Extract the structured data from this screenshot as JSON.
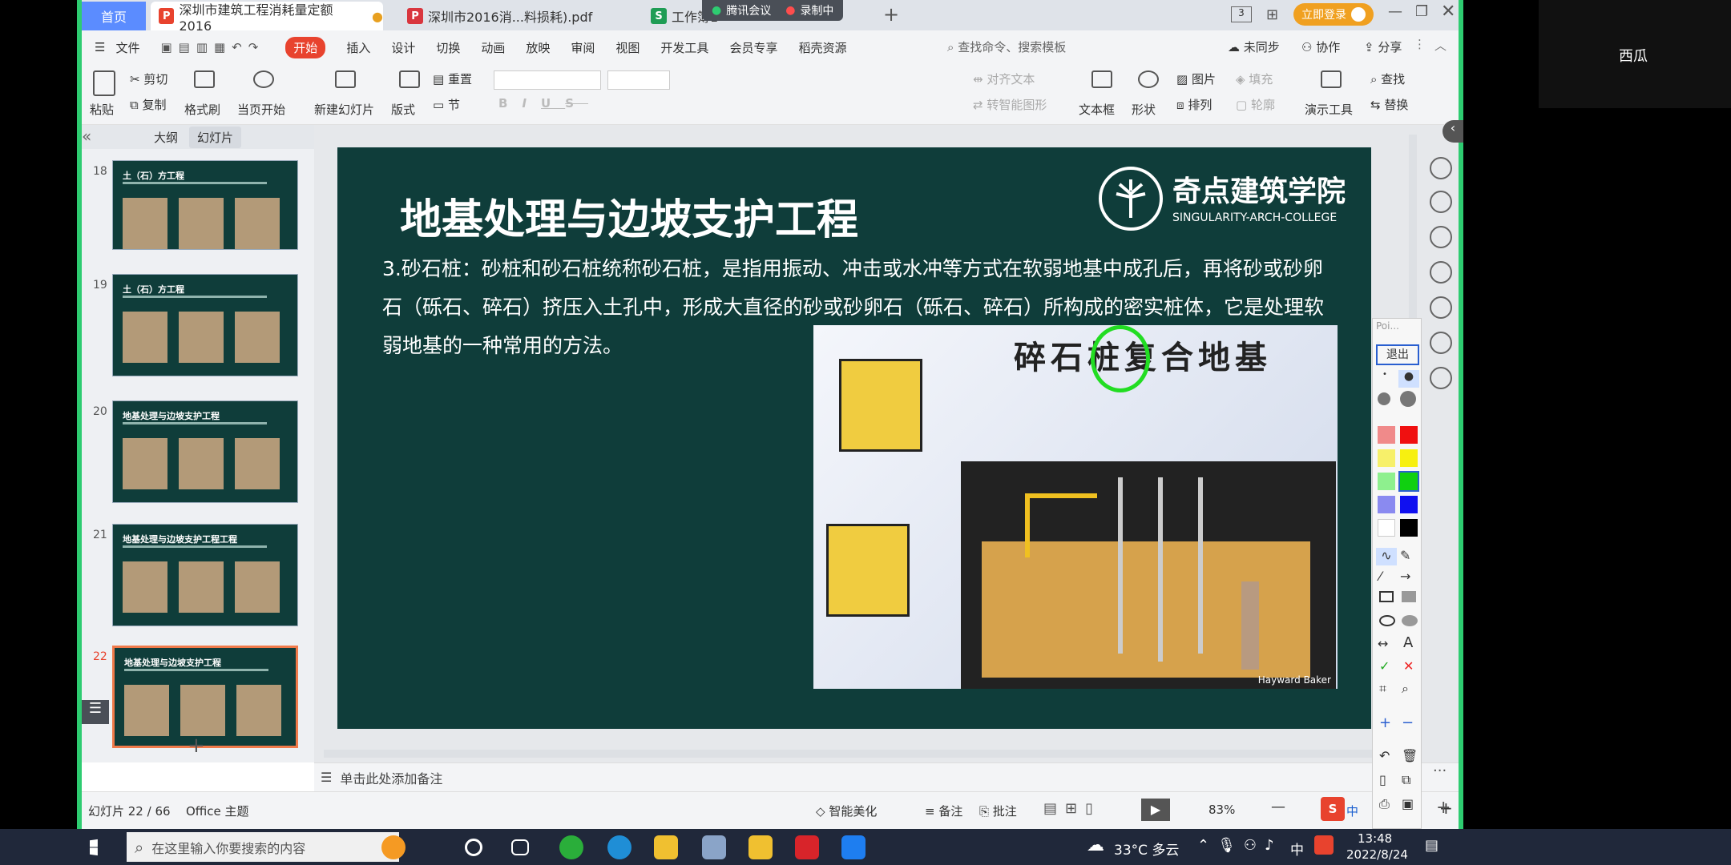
{
  "tabs": {
    "home": "首页",
    "doc1": "深圳市建筑工程消耗量定额2016",
    "doc2": "深圳市2016消...料损耗).pdf",
    "doc3": "工作簿1",
    "add": "+"
  },
  "meeting": {
    "app": "腾讯会议",
    "recording": "录制中"
  },
  "title_bar": {
    "page_indicator": "3",
    "login": "立即登录"
  },
  "menu": {
    "file": "文件",
    "items": [
      "开始",
      "插入",
      "设计",
      "切换",
      "动画",
      "放映",
      "审阅",
      "视图",
      "开发工具",
      "会员专享",
      "稻壳资源"
    ],
    "search": "查找命令、搜索模板",
    "sync": "未同步",
    "collab": "协作",
    "share": "分享"
  },
  "toolbar": {
    "paste": "粘贴",
    "cut": "剪切",
    "copy": "复制",
    "format_brush": "格式刷",
    "play_current": "当页开始",
    "new_slide": "新建幻灯片",
    "layout": "版式",
    "reset": "重置",
    "section": "节",
    "align_text": "对齐文本",
    "convert_smart": "转智能图形",
    "textbox": "文本框",
    "shape": "形状",
    "picture": "图片",
    "arrange": "排列",
    "fill": "填充",
    "outline": "轮廓",
    "presenter": "演示工具",
    "find": "查找",
    "replace": "替换",
    "bold": "B",
    "italic": "I",
    "underline": "U",
    "strike": "S"
  },
  "panel": {
    "outline": "大纲",
    "slides": "幻灯片",
    "add": "+"
  },
  "thumbnails": [
    {
      "num": "18",
      "title": "土（石）方工程"
    },
    {
      "num": "19",
      "title": "土（石）方工程"
    },
    {
      "num": "20",
      "title": "地基处理与边坡支护工程"
    },
    {
      "num": "21",
      "title": "地基处理与边坡支护工程工程"
    },
    {
      "num": "22",
      "title": "地基处理与边坡支护工程"
    }
  ],
  "slide": {
    "title": "地基处理与边坡支护工程",
    "logo_cn": "奇点建筑学院",
    "logo_en": "SINGULARITY-ARCH-COLLEGE",
    "body": "3.砂石桩：砂桩和砂石桩统称砂石桩，是指用振动、冲击或水冲等方式在软弱地基中成孔后，再将砂或砂卵石（砾石、碎石）挤压入土孔中，形成大直径的砂或砂卵石（砾石、碎石）所构成的密实桩体，它是处理软弱地基的一种常用的方法。",
    "figure_title": "碎石桩复合地基",
    "credit": "Hayward Baker"
  },
  "notes": "单击此处添加备注",
  "status": {
    "slide_no": "幻灯片 22 / 66",
    "theme": "Office 主题",
    "beautify": "智能美化",
    "notes": "备注",
    "comment": "批注",
    "zoom": "83%"
  },
  "pen": {
    "pointer": "Poi...",
    "exit": "退出"
  },
  "viewer": "西瓜",
  "taskbar": {
    "search": "在这里输入你要搜索的内容",
    "weather": "33°C 多云",
    "ime": "中",
    "time": "13:48",
    "date": "2022/8/24"
  },
  "colors": {
    "accent": "#2ecc71",
    "slide_bg": "#0f3d3a",
    "wps_red": "#e8432e",
    "tab_blue": "#5b8cff"
  }
}
